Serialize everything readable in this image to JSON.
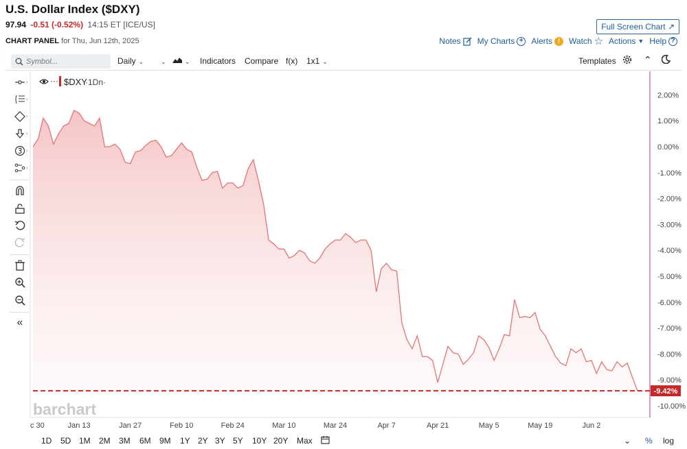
{
  "header": {
    "title": "U.S. Dollar Index ($DXY)",
    "price": "97.94",
    "change": "-0.51 (-0.52%)",
    "time": "14:15 ET [ICE/US]",
    "fullscreen_label": "Full Screen Chart",
    "panel_label": "CHART PANEL",
    "panel_date": "for Thu, Jun 12th, 2025"
  },
  "links": {
    "notes": "Notes",
    "my_charts": "My Charts",
    "alerts": "Alerts",
    "watch": "Watch",
    "actions": "Actions",
    "help": "Help"
  },
  "toolbar": {
    "search_placeholder": "Symbol...",
    "interval": "Daily",
    "indicators": "Indicators",
    "compare": "Compare",
    "fx": "f(x)",
    "layout": "1x1",
    "templates": "Templates"
  },
  "legend": {
    "symbol": "$DXY",
    "interval": "·1Dn·"
  },
  "watermark": "barchart",
  "ranges": [
    "1D",
    "5D",
    "1M",
    "2M",
    "3M",
    "6M",
    "9M",
    "1Y",
    "2Y",
    "3Y",
    "5Y",
    "10Y",
    "20Y",
    "Max"
  ],
  "scale_options": {
    "percent": "%",
    "log": "log"
  },
  "colors": {
    "line": "#e57373",
    "fill_top": "#f4c2c4",
    "last_value": "#c62828",
    "link": "#1f5d99",
    "right_axis": "#b03a8c"
  },
  "chart_data": {
    "type": "area",
    "ylabel": "",
    "y_unit": "%",
    "ylim": [
      -10.6,
      2.6
    ],
    "y_ticks": [
      "2.00%",
      "1.00%",
      "0.00%",
      "-1.00%",
      "-2.00%",
      "-3.00%",
      "-4.00%",
      "-5.00%",
      "-6.00%",
      "-7.00%",
      "-8.00%",
      "-9.00%",
      "-10.00%"
    ],
    "y_tick_values": [
      2,
      1,
      0,
      -1,
      -2,
      -3,
      -4,
      -5,
      -6,
      -7,
      -8,
      -9,
      -10
    ],
    "x_ticks": [
      {
        "label": "c 30",
        "i": 0
      },
      {
        "label": "Jan 13",
        "i": 9
      },
      {
        "label": "Jan 27",
        "i": 19
      },
      {
        "label": "Feb 10",
        "i": 29
      },
      {
        "label": "Feb 24",
        "i": 39
      },
      {
        "label": "Mar 10",
        "i": 49
      },
      {
        "label": "Mar 24",
        "i": 59
      },
      {
        "label": "Apr 7",
        "i": 69
      },
      {
        "label": "Apr 21",
        "i": 79
      },
      {
        "label": "May 5",
        "i": 89
      },
      {
        "label": "May 19",
        "i": 99
      },
      {
        "label": "Jun 2",
        "i": 109
      }
    ],
    "n_points": 119,
    "last_value": -9.42,
    "last_value_label": "-9.42%",
    "series": [
      {
        "values": [
          0.0,
          0.3,
          1.1,
          0.8,
          0.1,
          0.5,
          0.8,
          0.9,
          1.4,
          1.3,
          1.0,
          0.9,
          0.8,
          1.1,
          0.0,
          0.0,
          0.1,
          -0.1,
          -0.6,
          -0.65,
          -0.2,
          -0.15,
          0.05,
          0.2,
          0.25,
          0.0,
          -0.4,
          -0.35,
          -0.1,
          0.15,
          -0.1,
          -0.2,
          -0.8,
          -1.3,
          -1.25,
          -1.0,
          -0.95,
          -1.6,
          -1.4,
          -1.4,
          -1.6,
          -1.5,
          -0.85,
          -0.5,
          -1.3,
          -2.2,
          -3.6,
          -3.75,
          -3.95,
          -3.95,
          -4.3,
          -4.2,
          -4.0,
          -4.1,
          -4.4,
          -4.5,
          -4.3,
          -3.95,
          -3.75,
          -3.6,
          -3.6,
          -3.35,
          -3.5,
          -3.7,
          -3.6,
          -3.6,
          -4.0,
          -5.6,
          -4.7,
          -4.5,
          -4.75,
          -4.8,
          -6.8,
          -7.45,
          -7.8,
          -7.3,
          -8.1,
          -8.1,
          -8.25,
          -9.1,
          -8.4,
          -7.7,
          -7.95,
          -8.0,
          -8.4,
          -8.2,
          -7.95,
          -7.3,
          -7.45,
          -7.75,
          -8.25,
          -7.8,
          -7.25,
          -7.3,
          -5.9,
          -6.6,
          -6.55,
          -6.6,
          -6.4,
          -7.05,
          -7.3,
          -7.7,
          -8.1,
          -8.35,
          -8.45,
          -7.8,
          -7.95,
          -7.8,
          -8.3,
          -8.25,
          -8.75,
          -8.3,
          -8.6,
          -8.65,
          -8.3,
          -8.5,
          -8.35,
          -8.9,
          -9.42
        ]
      }
    ]
  }
}
